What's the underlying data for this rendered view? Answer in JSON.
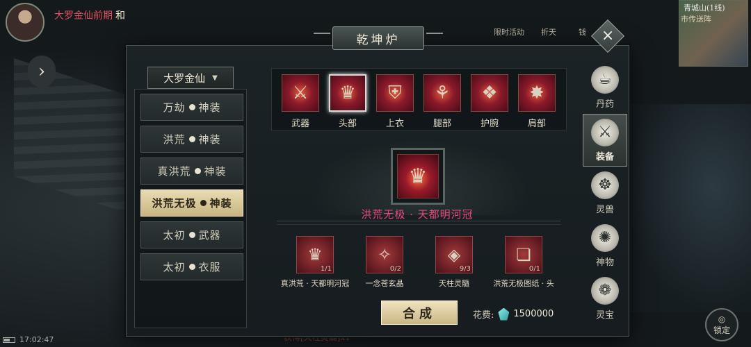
{
  "player": {
    "name": "大罗金仙前期",
    "tag": "和"
  },
  "top_hints": [
    "限时活动",
    "折天",
    "钱"
  ],
  "minimap": {
    "location": "青城山(1线)",
    "npc": "市传送阵"
  },
  "window": {
    "title": "乾坤炉",
    "close_label": "×"
  },
  "tier_select": {
    "value": "大罗金仙"
  },
  "categories": [
    {
      "label": "万劫",
      "suffix": "神装"
    },
    {
      "label": "洪荒",
      "suffix": "神装"
    },
    {
      "label": "真洪荒",
      "suffix": "神装"
    },
    {
      "label": "洪荒无极",
      "suffix": "神装"
    },
    {
      "label": "太初",
      "suffix": "武器"
    },
    {
      "label": "太初",
      "suffix": "衣服"
    }
  ],
  "active_category_index": 3,
  "slots": [
    {
      "label": "武器",
      "icon": "sword-icon",
      "glyph": "⚔"
    },
    {
      "label": "头部",
      "icon": "crown-icon",
      "glyph": "♛"
    },
    {
      "label": "上衣",
      "icon": "armor-icon",
      "glyph": "⛨"
    },
    {
      "label": "腿部",
      "icon": "greaves-icon",
      "glyph": "⚘"
    },
    {
      "label": "护腕",
      "icon": "bracer-icon",
      "glyph": "❖"
    },
    {
      "label": "肩部",
      "icon": "shoulder-icon",
      "glyph": "✸"
    }
  ],
  "selected_slot_index": 1,
  "item": {
    "name": "洪荒无极 · 天都明河冠",
    "icon": "crown-icon",
    "glyph": "♛"
  },
  "materials": [
    {
      "label": "真洪荒 · 天都明河冠",
      "count": "1/1",
      "icon": "crown-icon",
      "glyph": "♛"
    },
    {
      "label": "一念苍玄晶",
      "count": "0/2",
      "icon": "crystal-icon",
      "glyph": "✧"
    },
    {
      "label": "天柱灵髓",
      "count": "9/3",
      "icon": "ore-icon",
      "glyph": "◈"
    },
    {
      "label": "洪荒无极图纸 · 头",
      "count": "0/1",
      "icon": "scroll-icon",
      "glyph": "❏"
    }
  ],
  "synth_button": "合成",
  "cost": {
    "label": "花费:",
    "value": "1500000",
    "icon": "spirit-stone-icon"
  },
  "side_tabs": [
    {
      "label": "丹药",
      "icon": "pill-bowl-icon",
      "glyph": "☕"
    },
    {
      "label": "装备",
      "icon": "equipment-icon",
      "glyph": "⚔"
    },
    {
      "label": "灵兽",
      "icon": "paw-icon",
      "glyph": "☸"
    },
    {
      "label": "神物",
      "icon": "fan-icon",
      "glyph": "✺"
    },
    {
      "label": "灵宝",
      "icon": "treasure-icon",
      "glyph": "❁"
    }
  ],
  "active_side_tab_index": 1,
  "lock_button": "锁定",
  "clock": "17:02:47",
  "chat_line": "获得[天柱灵髓]x1",
  "colors": {
    "accent_gold": "#e8dcb2",
    "item_name": "#e8487a",
    "panel_bg": "#1b2326"
  }
}
